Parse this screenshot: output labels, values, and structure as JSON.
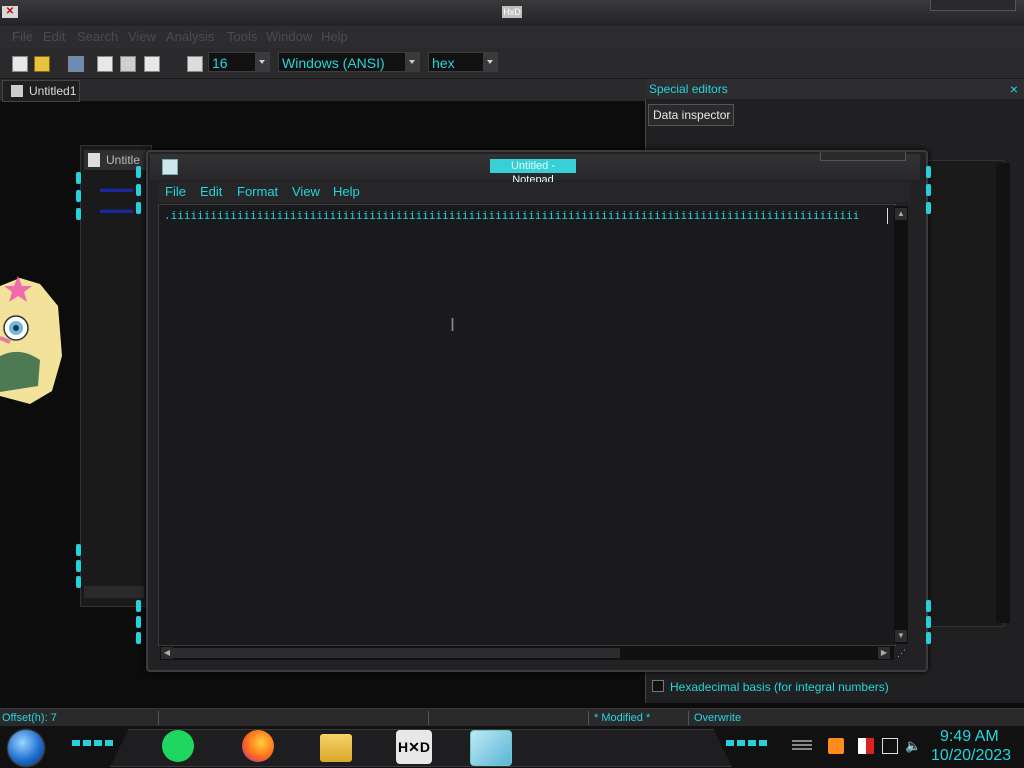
{
  "hxd": {
    "app_icon_text": "✕",
    "title_text": "HxD",
    "menu": [
      "File",
      "Edit",
      "Search",
      "View",
      "Analysis",
      "Tools",
      "Window",
      "Help"
    ],
    "toolbar": {
      "bytes_per_row": "16",
      "charset": "Windows (ANSI)",
      "offset_base": "hex"
    },
    "doc_tab": "Untitled1",
    "special_editors": {
      "title": "Special editors",
      "close": "×",
      "tab": "Data inspector",
      "hex_basis_label": "Hexadecimal basis (for integral numbers)"
    },
    "status": {
      "offset": "Offset(h): 7",
      "modified": "* Modified *",
      "mode": "Overwrite"
    },
    "bg_window_title": "Untitle"
  },
  "notepad": {
    "title": "Untitled - Notepad",
    "menu": [
      "File",
      "Edit",
      "Format",
      "View",
      "Help"
    ],
    "content": ".iiiiiiiiiiiiiiiiiiiiiiiiiiiiiiiiiiiiiiiiiiiiiiiiiiiiiiiiiiiiiiiiiiiiiiiiiiiiiiiiiiiiiiiiiiiiiiiiiiiiiiii"
  },
  "taskbar": {
    "time": "9:49 AM",
    "date": "10/20/2023",
    "apps": [
      "spotify-icon",
      "firefox-icon",
      "file-explorer-icon",
      "hxd-icon",
      "notepad-icon"
    ],
    "tray": [
      "sound-warning-icon",
      "action-center-flag-icon",
      "network-icon",
      "volume-icon"
    ]
  },
  "colors": {
    "accent": "#22d6dd",
    "background": "#0c0c0d"
  }
}
